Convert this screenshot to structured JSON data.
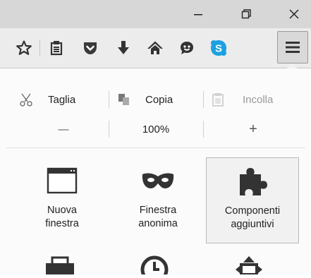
{
  "window": {
    "buttons": [
      "minimize-icon",
      "restore-icon",
      "close-icon"
    ]
  },
  "toolbar": {
    "icons": [
      "star-bookmark-icon",
      "reading-list-icon",
      "pocket-icon",
      "download-icon",
      "home-icon",
      "chat-bubble-icon",
      "skype-icon",
      "hamburger-menu-icon"
    ],
    "accent": "#1ba1e2"
  },
  "edit": {
    "cut": "Taglia",
    "copy": "Copia",
    "paste": "Incolla"
  },
  "zoom": {
    "minus": "—",
    "level": "100%",
    "plus": "+"
  },
  "tiles": [
    {
      "line1": "Nuova",
      "line2": "finestra",
      "icon": "new-window-icon"
    },
    {
      "line1": "Finestra",
      "line2": "anonima",
      "icon": "private-mask-icon"
    },
    {
      "line1": "Componenti",
      "line2": "aggiuntivi",
      "icon": "puzzle-addons-icon"
    }
  ],
  "bottom_icons": [
    "print-icon",
    "history-icon",
    "fullscreen-icon"
  ]
}
